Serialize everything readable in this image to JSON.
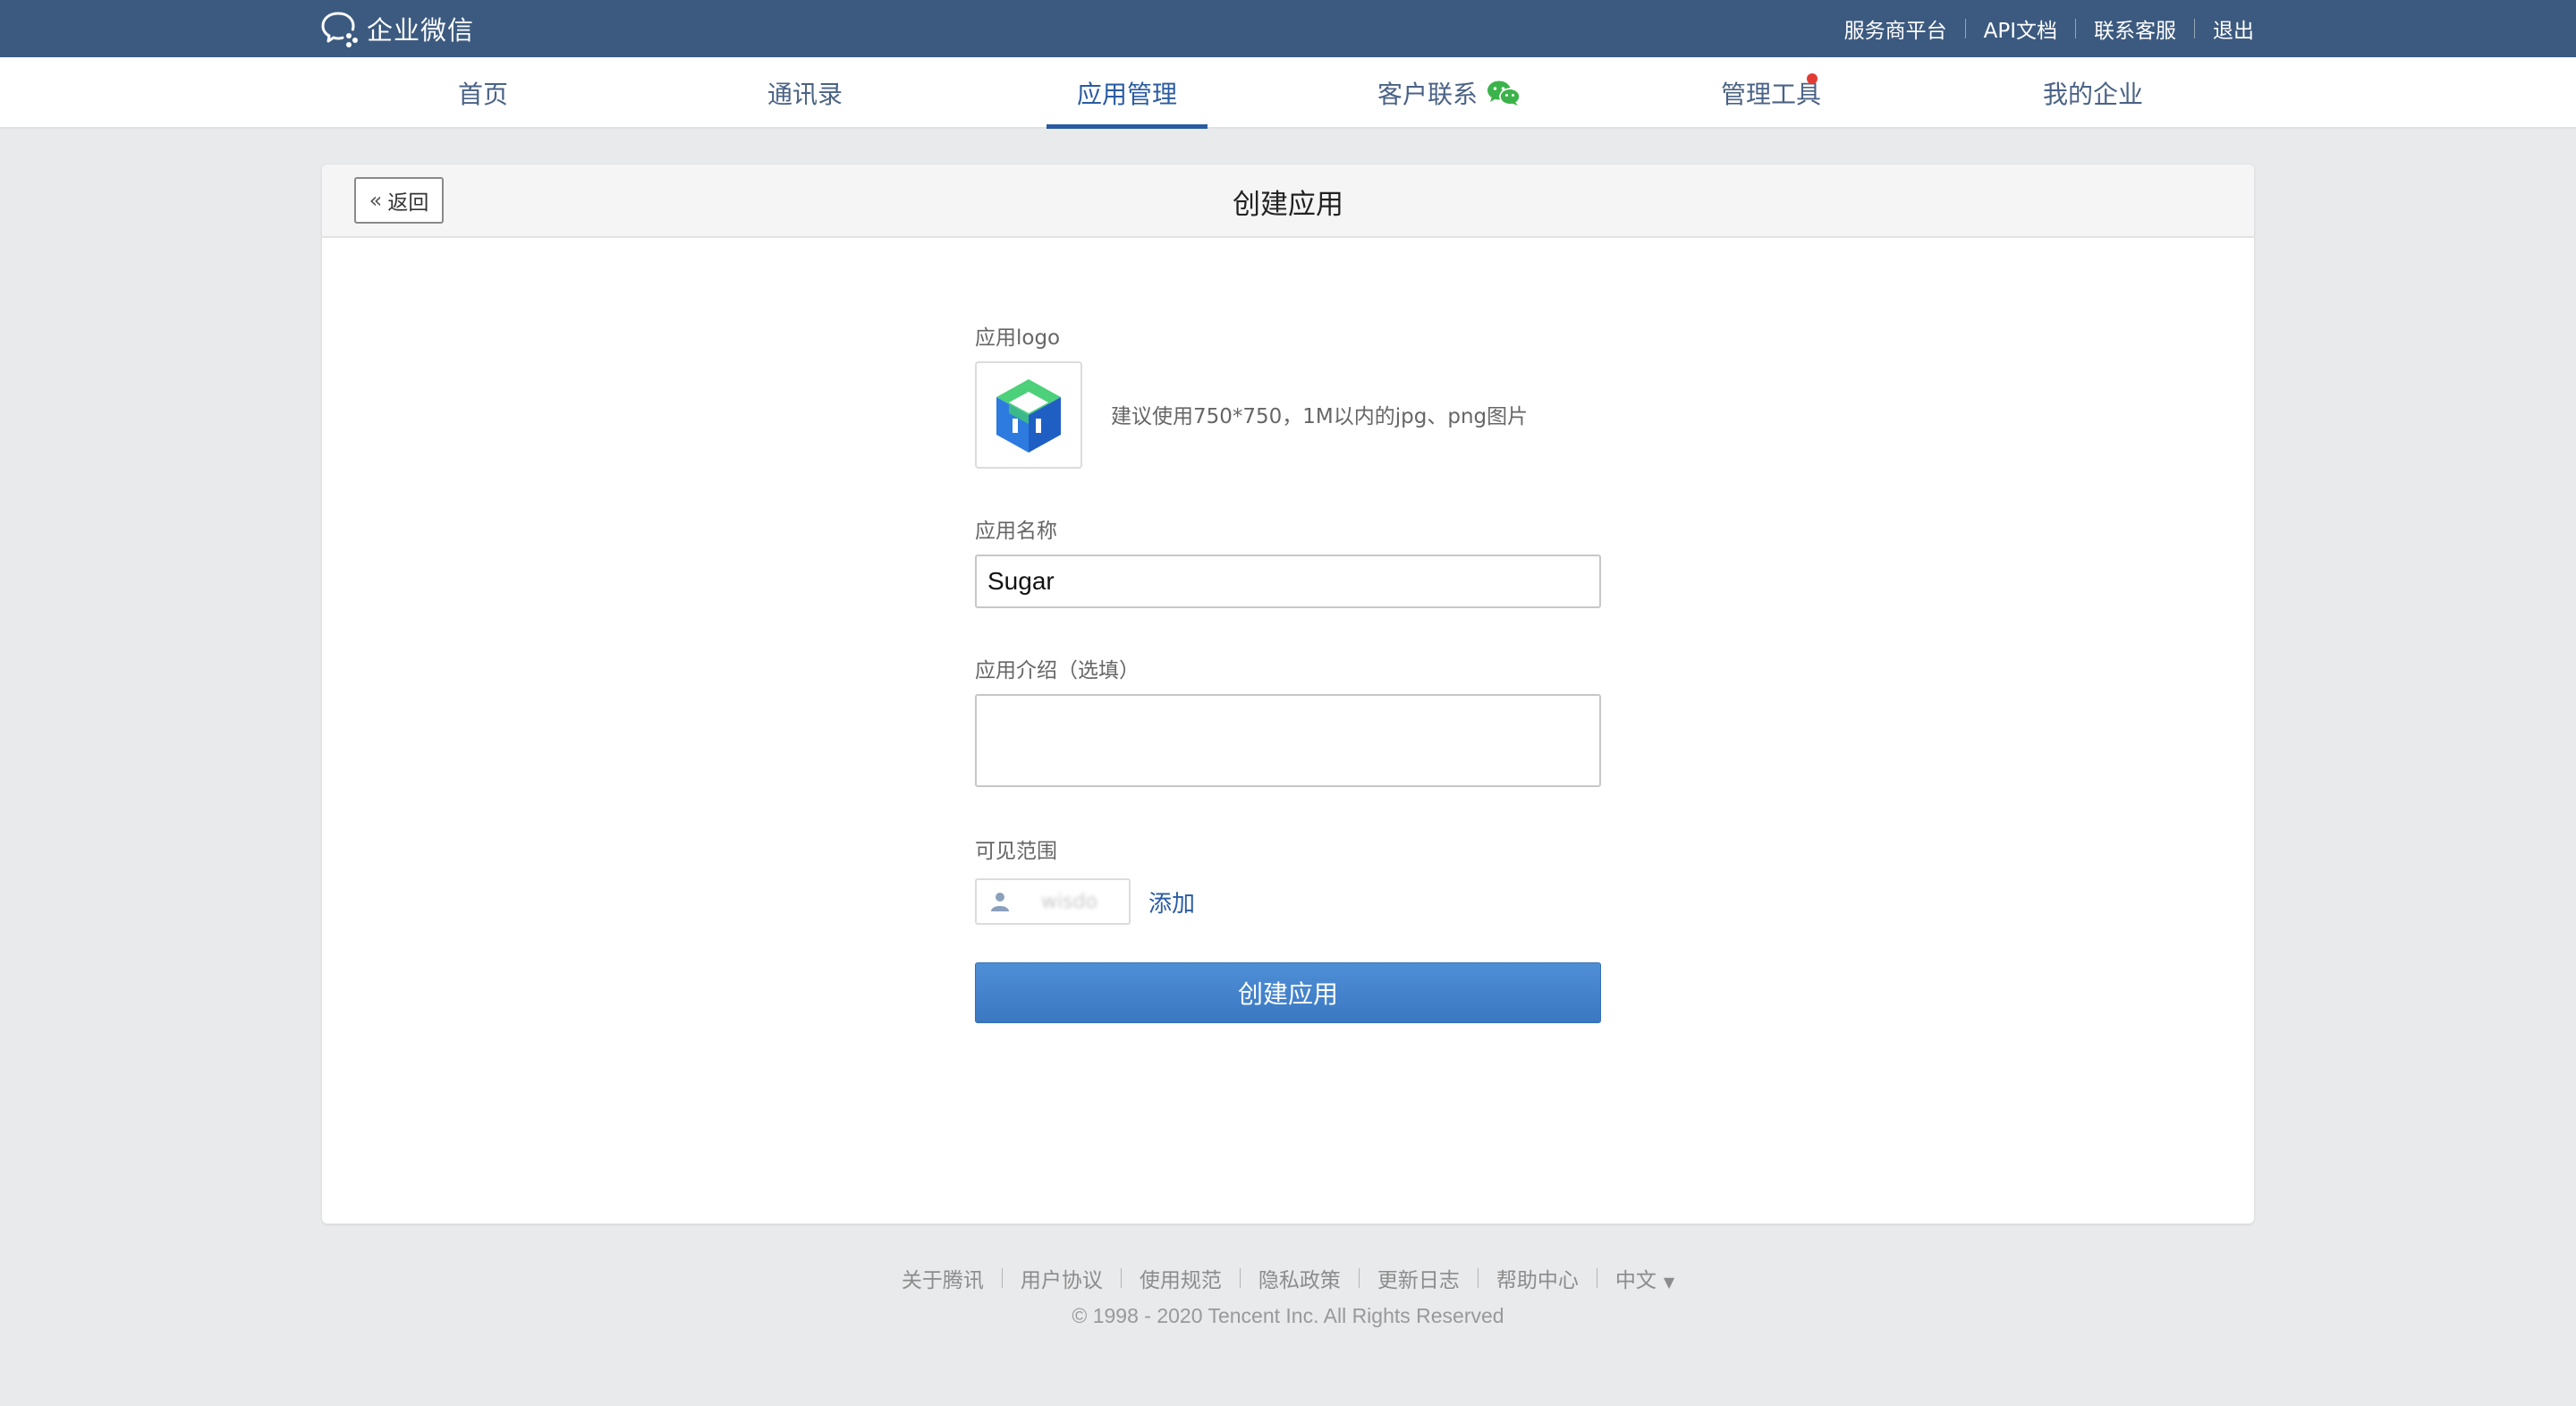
{
  "topbar": {
    "brand": "企业微信",
    "links": [
      "服务商平台",
      "API文档",
      "联系客服",
      "退出"
    ]
  },
  "nav": {
    "items": [
      "首页",
      "通讯录",
      "应用管理",
      "客户联系",
      "管理工具",
      "我的企业"
    ],
    "active": "应用管理"
  },
  "card": {
    "back_label": "返回",
    "title": "创建应用"
  },
  "form": {
    "logo_label": "应用logo",
    "logo_hint": "建议使用750*750，1M以内的jpg、png图片",
    "name_label": "应用名称",
    "name_value": "Sugar",
    "intro_label": "应用介绍（选填）",
    "intro_value": "",
    "scope_label": "可见范围",
    "scope_member": "wisdo",
    "add_label": "添加",
    "submit_label": "创建应用"
  },
  "footer": {
    "links": [
      "关于腾讯",
      "用户协议",
      "使用规范",
      "隐私政策",
      "更新日志",
      "帮助中心",
      "中文"
    ],
    "copyright": "© 1998 - 2020 Tencent Inc. All Rights Reserved"
  },
  "colors": {
    "topbar": "#3c5a80",
    "nav_active": "#2a5ba3",
    "primary_button": "#4a88cf",
    "badge_red": "#e23b33",
    "page_background": "#e9eaec"
  }
}
